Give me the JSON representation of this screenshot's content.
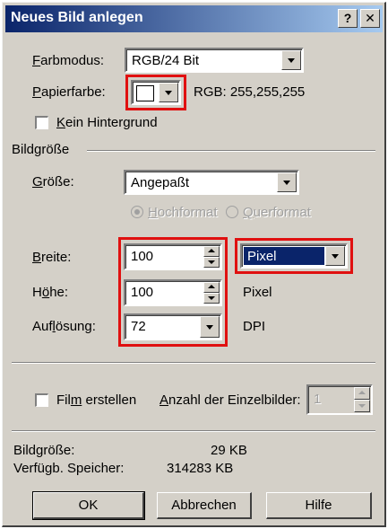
{
  "window": {
    "title": "Neues Bild anlegen",
    "help_label": "?",
    "close_label": "✕"
  },
  "farbmodus": {
    "label_ul": "F",
    "label_rest": "arbmodus:",
    "value": "RGB/24 Bit"
  },
  "papierfarbe": {
    "label_ul": "P",
    "label_rest": "apierfarbe:",
    "swatch_color": "#ffffff",
    "rgb_text": "RGB: 255,255,255"
  },
  "kein_hintergrund": {
    "label_ul": "K",
    "label_rest": "ein Hintergrund",
    "checked": false
  },
  "bildgroesse_section": {
    "label": "Bildgröße"
  },
  "groesse": {
    "label_ul": "G",
    "label_rest": "röße:",
    "value": "Angepaßt"
  },
  "orientation": {
    "hoch_ul": "H",
    "hoch_rest": "ochformat",
    "quer_ul": "Q",
    "quer_rest": "uerformat",
    "selected": "hochformat"
  },
  "breite": {
    "label_ul": "B",
    "label_rest": "reite:",
    "value": "100",
    "unit_selected": "Pixel"
  },
  "hoehe": {
    "label_pre": "H",
    "label_ul": "ö",
    "label_rest": "he:",
    "value": "100",
    "unit": "Pixel"
  },
  "aufloesung": {
    "label_pre": "Auf",
    "label_ul": "l",
    "label_rest": "ösung:",
    "value": "72",
    "unit": "DPI"
  },
  "film": {
    "label_pre": "Fil",
    "label_ul": "m",
    "label_rest": " erstellen",
    "checked": false,
    "frames_label_ul": "A",
    "frames_label_rest": "nzahl der Einzelbilder:",
    "frames_value": "1"
  },
  "info": {
    "bildgroesse_label": "Bildgröße:",
    "bildgroesse_value": "29  KB",
    "speicher_label": "Verfügb. Speicher:",
    "speicher_value": "314283  KB"
  },
  "buttons": {
    "ok": "OK",
    "abbrechen": "Abbrechen",
    "hilfe": "Hilfe"
  },
  "colors": {
    "highlight": "#e01010",
    "titlebar": "#0a246a",
    "selection": "#0a246a"
  }
}
